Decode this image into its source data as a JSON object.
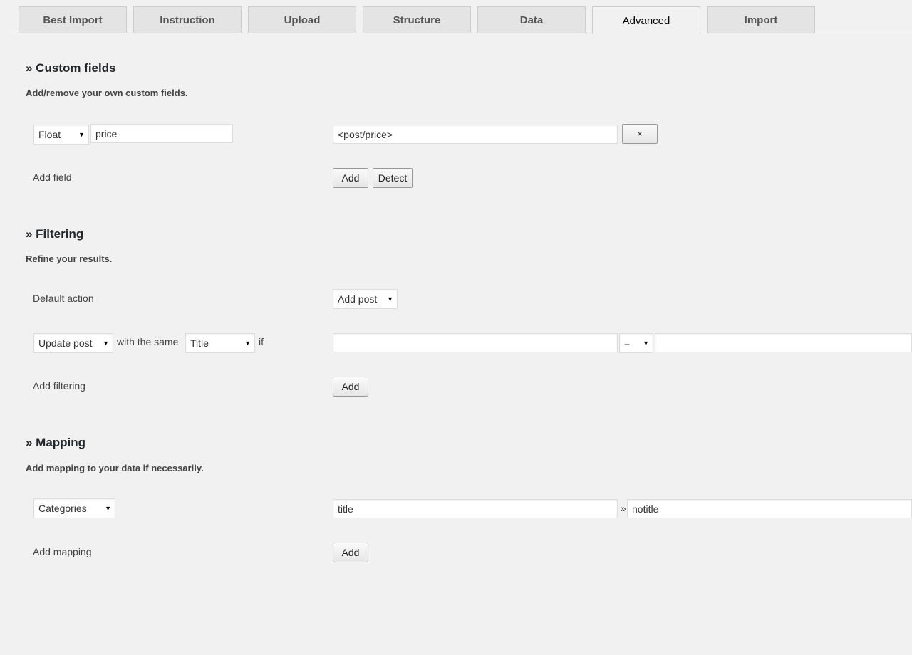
{
  "tabs": [
    {
      "label": "Best Import"
    },
    {
      "label": "Instruction"
    },
    {
      "label": "Upload"
    },
    {
      "label": "Structure"
    },
    {
      "label": "Data"
    },
    {
      "label": "Advanced",
      "active": true
    },
    {
      "label": "Import"
    }
  ],
  "custom_fields": {
    "title": "» Custom fields",
    "description": "Add/remove your own custom fields.",
    "row": {
      "type_value": "Float",
      "name_value": "price",
      "path_value": "<post/price>",
      "remove_label": "×"
    },
    "add_label": "Add field",
    "add_button": "Add",
    "detect_button": "Detect"
  },
  "filtering": {
    "title": "» Filtering",
    "description": "Refine your results.",
    "default_action_label": "Default action",
    "default_action_value": "Add post",
    "rule": {
      "action_value": "Update post",
      "with_same_text": "with the same",
      "field_value": "Title",
      "if_text": "if",
      "left_value": "",
      "operator_value": "=",
      "right_value": ""
    },
    "add_label": "Add filtering",
    "add_button": "Add"
  },
  "mapping": {
    "title": "» Mapping",
    "description": "Add mapping to your data if necessarily.",
    "row": {
      "taxonomy_value": "Categories",
      "from_value": "title",
      "separator": "»",
      "to_value": "notitle"
    },
    "add_label": "Add mapping",
    "add_button": "Add"
  },
  "icons": {
    "select_arrow": "dropdown-arrow-icon",
    "remove": "close-icon"
  }
}
